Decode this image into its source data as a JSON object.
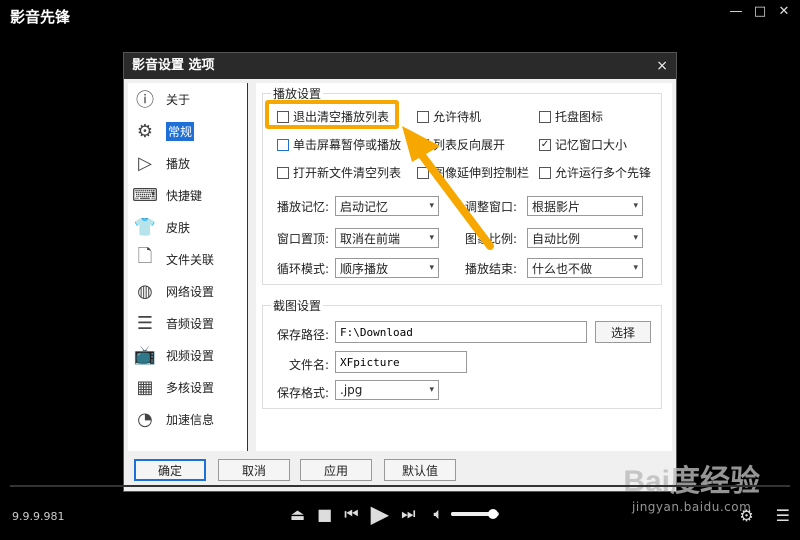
{
  "app": {
    "title": "影音先锋",
    "version": "9.9.9.981",
    "window_controls": [
      "—",
      "□",
      "✕"
    ]
  },
  "dialog": {
    "title": "影音设置 选项",
    "close_label": "×",
    "sidebar": [
      {
        "label": "关于",
        "icon": "info-icon",
        "glyph": "ⓘ"
      },
      {
        "label": "常规",
        "icon": "gear-icon",
        "glyph": "⚙",
        "active": true
      },
      {
        "label": "播放",
        "icon": "play-icon",
        "glyph": "▷"
      },
      {
        "label": "快捷键",
        "icon": "keyboard-icon",
        "glyph": "⌨"
      },
      {
        "label": "皮肤",
        "icon": "shirt-icon",
        "glyph": "👕"
      },
      {
        "label": "文件关联",
        "icon": "document-icon",
        "glyph": "🗋"
      },
      {
        "label": "网络设置",
        "icon": "globe-icon",
        "glyph": "◍"
      },
      {
        "label": "音频设置",
        "icon": "list-icon",
        "glyph": "☰"
      },
      {
        "label": "视频设置",
        "icon": "tv-icon",
        "glyph": "📺"
      },
      {
        "label": "多核设置",
        "icon": "cpu-icon",
        "glyph": "▦"
      },
      {
        "label": "加速信息",
        "icon": "speedometer-icon",
        "glyph": "◔"
      }
    ],
    "playback": {
      "group_label": "播放设置",
      "checkboxes": [
        {
          "label": "退出清空播放列表",
          "checked": false
        },
        {
          "label": "允许待机",
          "checked": false
        },
        {
          "label": "托盘图标",
          "checked": false
        },
        {
          "label": "单击屏幕暂停或播放",
          "checked": false
        },
        {
          "label": "列表反向展开",
          "checked": false
        },
        {
          "label": "记忆窗口大小",
          "checked": true
        },
        {
          "label": "打开新文件清空列表",
          "checked": false
        },
        {
          "label": "图像延伸到控制栏",
          "checked": false
        },
        {
          "label": "允许运行多个先锋",
          "checked": false
        }
      ],
      "fields": [
        {
          "label": "播放记忆:",
          "value": "启动记忆"
        },
        {
          "label": "调整窗口:",
          "value": "根据影片"
        },
        {
          "label": "窗口置顶:",
          "value": "取消在前端"
        },
        {
          "label": "图象比例:",
          "value": "自动比例"
        },
        {
          "label": "循环模式:",
          "value": "顺序播放"
        },
        {
          "label": "播放结束:",
          "value": "什么也不做"
        }
      ]
    },
    "screenshot": {
      "group_label": "截图设置",
      "path_label": "保存路径:",
      "path_value": "F:\\Download",
      "browse_label": "选择",
      "filename_label": "文件名:",
      "filename_value": "XFpicture",
      "format_label": "保存格式:",
      "format_value": ".jpg"
    },
    "footer": {
      "ok": "确定",
      "cancel": "取消",
      "apply": "应用",
      "default": "默认值"
    }
  },
  "watermark": {
    "logo": "Bai度经验",
    "site": "jingyan.baidu.com"
  },
  "colors": {
    "accent": "#1e6fd6",
    "annotation": "#f7a800"
  },
  "player": {
    "volume_fraction": 0.9
  }
}
